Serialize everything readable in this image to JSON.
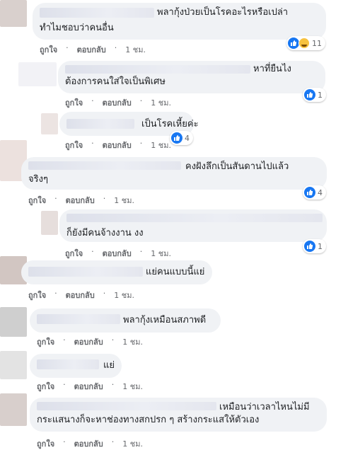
{
  "comments": [
    {
      "text": "พลากุ้งป่วยเป็นโรคอะไรหรือเปล่า",
      "text2": "ทำไมชอบว่าคนอื่น",
      "like": "ถูกใจ",
      "reply": "ตอบกลับ",
      "time": "1 ชม.",
      "reactions": "11"
    },
    {
      "text": "หาที่ยืนไง",
      "text2": "ต้องการคนใส่ใจเป็นพิเศษ",
      "like": "ถูกใจ",
      "reply": "ตอบกลับ",
      "time": "1 ชม.",
      "reactions": "1"
    },
    {
      "text": "เป็นโรคเหี้ยค่ะ",
      "like": "ถูกใจ",
      "reply": "ตอบกลับ",
      "time": "1 ชม.",
      "reactions": "4"
    },
    {
      "text": "คงฝังลึกเป็นสันดานไปแล้ว",
      "text2": "จริงๆ",
      "like": "ถูกใจ",
      "reply": "ตอบกลับ",
      "time": "1 ชม.",
      "reactions": "4"
    },
    {
      "text": "ก็ยังมีคนจ้างงาน งง",
      "like": "ถูกใจ",
      "reply": "ตอบกลับ",
      "time": "1 ชม.",
      "reactions": "1"
    },
    {
      "text": "แย่คนแบบนี้แย่",
      "like": "ถูกใจ",
      "reply": "ตอบกลับ",
      "time": "1 ชม."
    },
    {
      "text": "พลากุ้งเหมือนสภาพดี",
      "like": "ถูกใจ",
      "reply": "ตอบกลับ",
      "time": "1 ชม."
    },
    {
      "text": "แย่",
      "like": "ถูกใจ",
      "reply": "ตอบกลับ",
      "time": "1 ชม."
    },
    {
      "text": "เหมือนว่าเวลาไหนไม่มี",
      "text2": "กระแสนางก็จะหาช่องทางสกปรก ๆ สร้างกระแสให้ตัวเอง",
      "like": "ถูกใจ",
      "reply": "ตอบกลับ",
      "time": "1 ชม."
    }
  ],
  "colors": {
    "link": "#65676b",
    "bubble": "#f0f2f5",
    "like_blue": "#1877f2"
  }
}
